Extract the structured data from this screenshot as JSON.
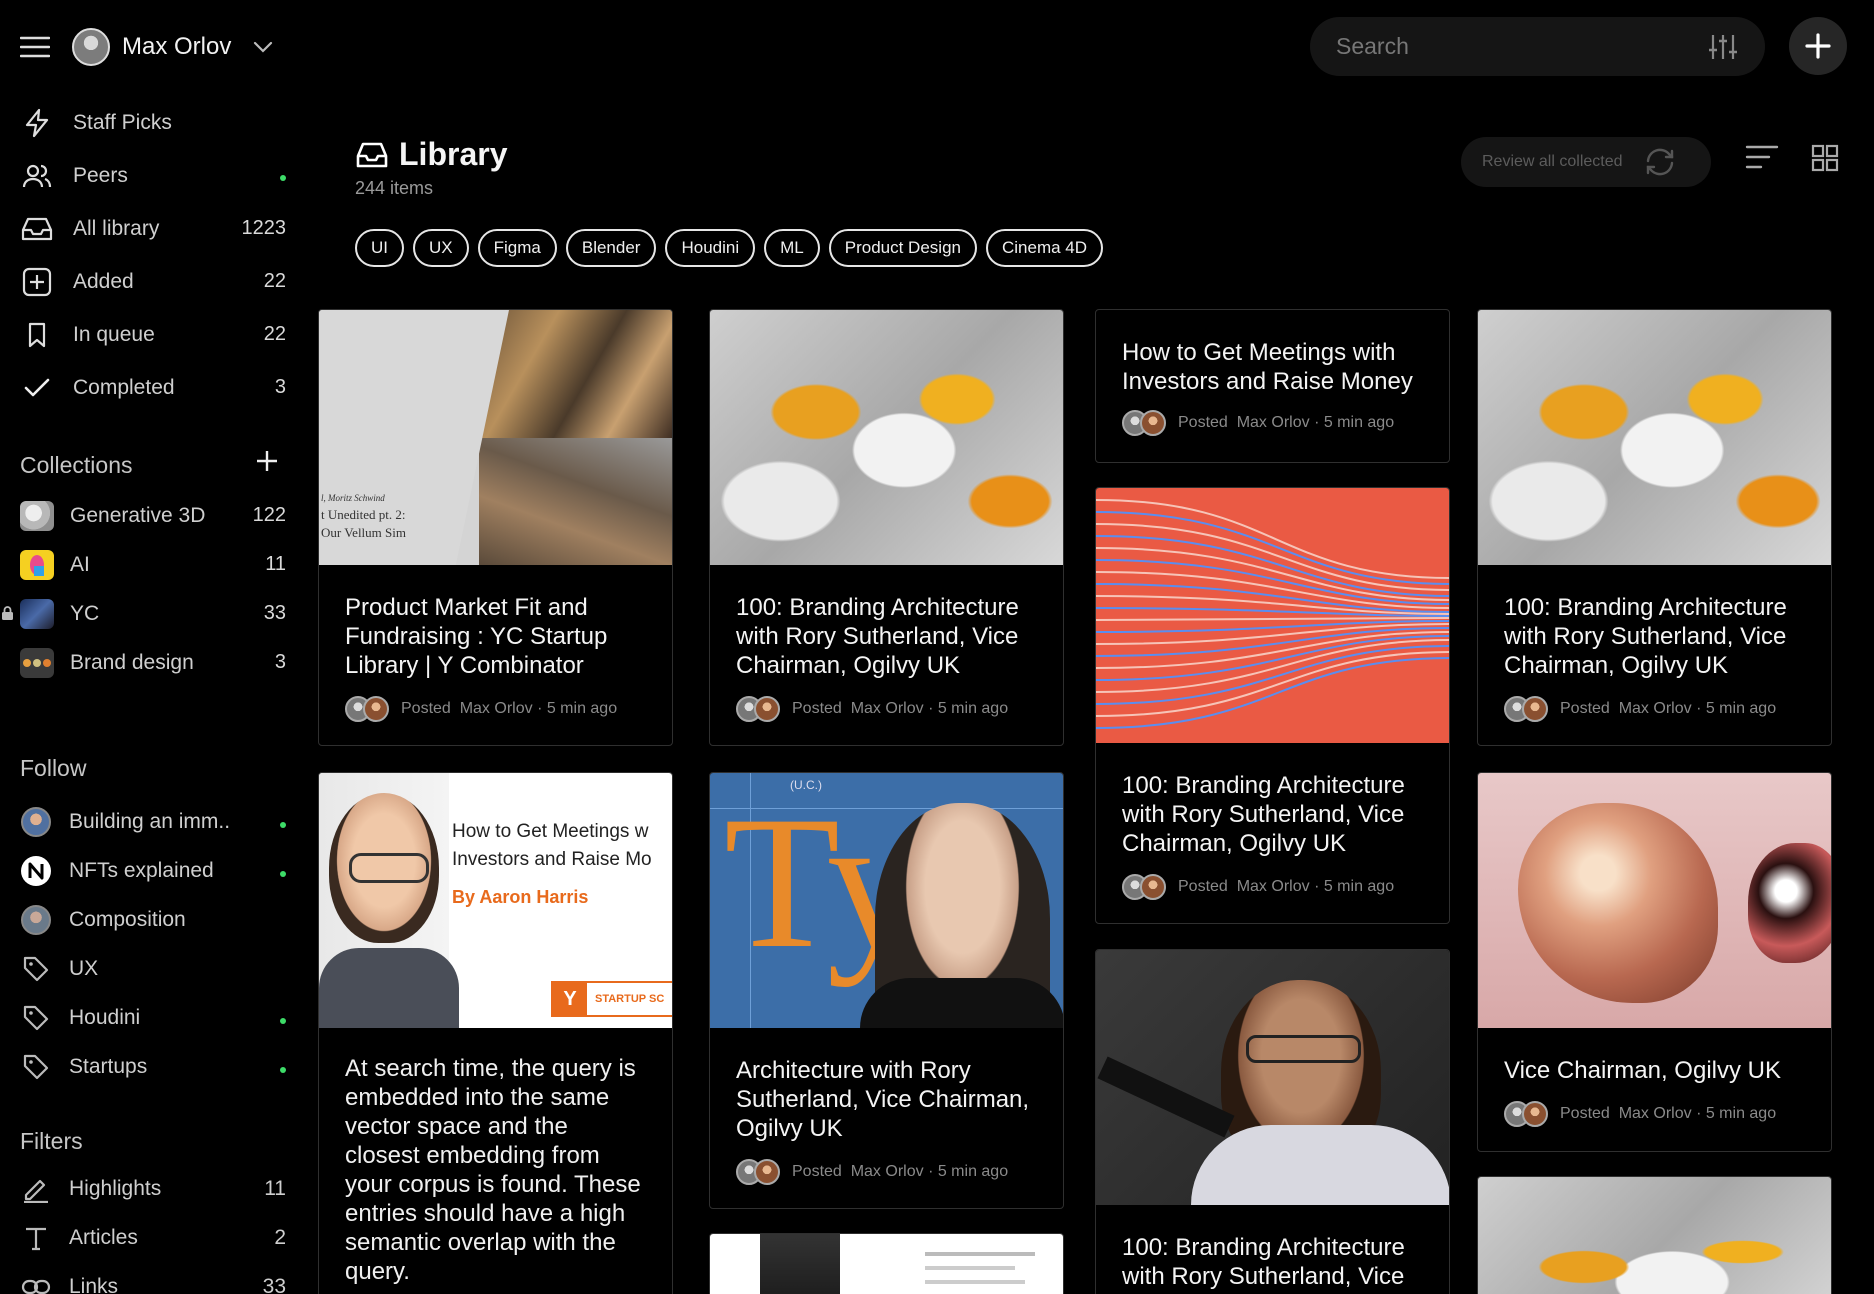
{
  "user": {
    "name": "Max Orlov"
  },
  "nav": [
    {
      "label": "Staff Picks",
      "icon": "lightning-icon",
      "count": ""
    },
    {
      "label": "Peers",
      "icon": "users-icon",
      "count": ""
    },
    {
      "label": "All library",
      "icon": "inbox-icon",
      "count": "1223"
    },
    {
      "label": "Added",
      "icon": "plus-square-icon",
      "count": "22"
    },
    {
      "label": "In queue",
      "icon": "bookmark-icon",
      "count": "22"
    },
    {
      "label": "Completed",
      "icon": "check-icon",
      "count": "3"
    }
  ],
  "collections": {
    "title": "Collections",
    "items": [
      {
        "label": "Generative 3D",
        "count": "122"
      },
      {
        "label": "AI",
        "count": "11"
      },
      {
        "label": "YC",
        "count": "33"
      },
      {
        "label": "Brand design",
        "count": "3"
      }
    ]
  },
  "follow": {
    "title": "Follow",
    "items": [
      {
        "label": "Building an imm..",
        "icon": "avatar"
      },
      {
        "label": "NFTs explained",
        "icon": "notion-icon"
      },
      {
        "label": "Composition",
        "icon": "avatar"
      },
      {
        "label": "UX",
        "icon": "tag-icon"
      },
      {
        "label": "Houdini",
        "icon": "tag-icon"
      },
      {
        "label": "Startups",
        "icon": "tag-icon"
      }
    ]
  },
  "filters": {
    "title": "Filters",
    "items": [
      {
        "label": "Highlights",
        "count": "11",
        "icon": "pen-icon"
      },
      {
        "label": "Articles",
        "count": "2",
        "icon": "text-icon"
      },
      {
        "label": "Links",
        "count": "33",
        "icon": "link-icon"
      }
    ]
  },
  "search": {
    "placeholder": "Search"
  },
  "library": {
    "title": "Library",
    "subtitle": "244 items",
    "review": "Review all collected"
  },
  "chips": [
    "UI",
    "UX",
    "Figma",
    "Blender",
    "Houdini",
    "ML",
    "Product Design",
    "Cinema 4D"
  ],
  "meta": {
    "posted": "Posted",
    "author": "Max Orlov",
    "time": "· 5 min ago"
  },
  "cards": {
    "c1": {
      "title": "Product Market Fit and Fundraising : YC Startup Library | Y Combinator",
      "img_text": [
        "l, Moritz Schwind",
        "t Unedited pt. 2:",
        "Our Vellum Sim"
      ]
    },
    "c2": {
      "title": "100: Branding Architecture with Rory Sutherland, Vice Chairman, Ogilvy UK"
    },
    "c3": {
      "title": "How to Get Meetings with Investors and Raise Money"
    },
    "c4": {
      "title": "100: Branding Architecture with Rory Sutherland, Vice Chairman, Ogilvy UK"
    },
    "c5": {
      "title": "100: Branding Architecture with Rory Sutherland, Vice Chairman, Ogilvy UK"
    },
    "c6": {
      "body": "At search time, the query is embedded into the same vector space and the closest embedding from your corpus is found. These entries should have a high semantic overlap with the query.",
      "img_title": "How to Get Meetings w Investors and Raise Mo",
      "img_author": "By Aaron Harris",
      "img_badge": "STARTUP SC",
      "img_logo": "Y"
    },
    "c7": {
      "title": "Architecture with Rory Sutherland, Vice Chairman, Ogilvy UK",
      "img_top": "(U.C.)",
      "img_big": "Ty"
    },
    "c8": {
      "title": "Vice Chairman, Ogilvy UK"
    },
    "c9": {
      "title": "100: Branding Architecture with Rory Sutherland, Vice"
    }
  }
}
